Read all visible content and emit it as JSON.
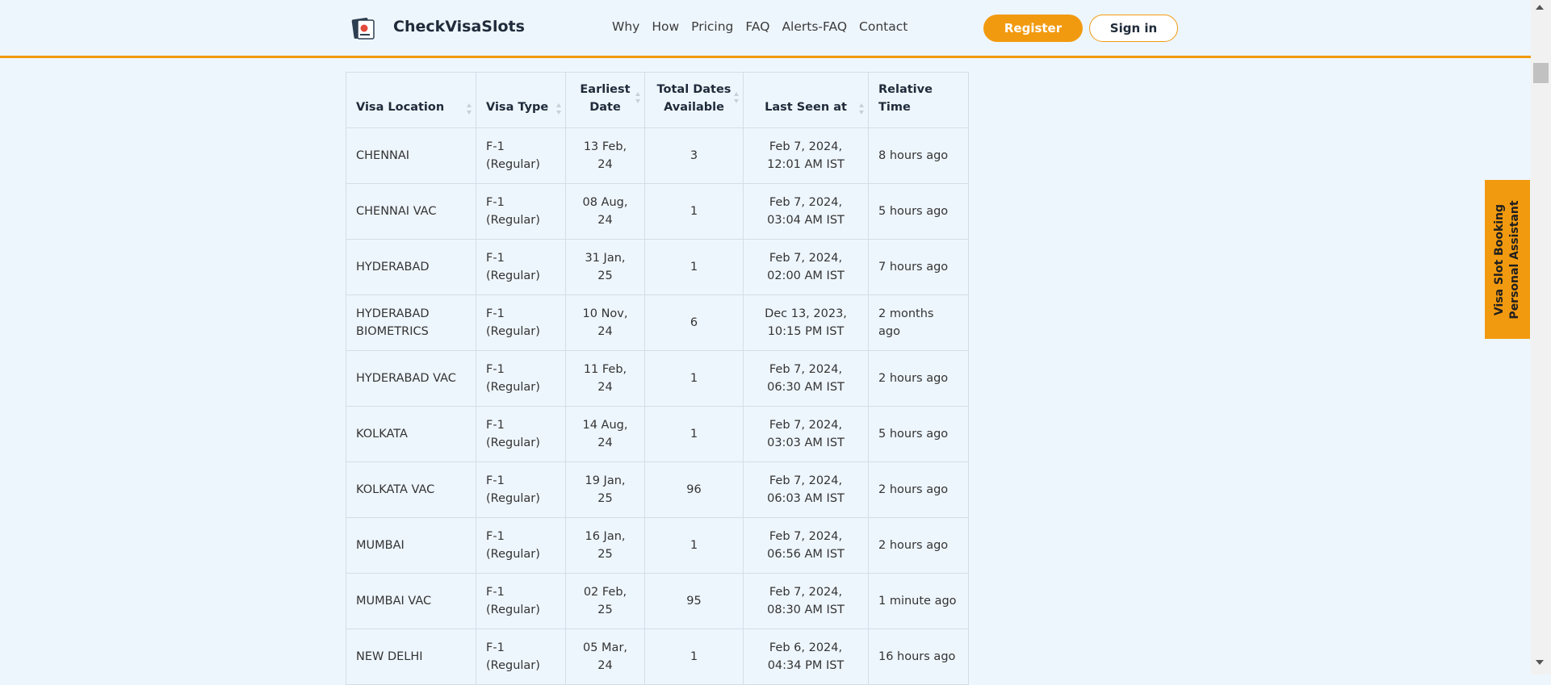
{
  "header": {
    "brand": "CheckVisaSlots",
    "nav": [
      "Why",
      "How",
      "Pricing",
      "FAQ",
      "Alerts-FAQ",
      "Contact"
    ],
    "register_label": "Register",
    "signin_label": "Sign in"
  },
  "table": {
    "columns": [
      {
        "line1": "",
        "line2": "Visa Location"
      },
      {
        "line1": "",
        "line2": "Visa Type"
      },
      {
        "line1": "Earliest",
        "line2": "Date"
      },
      {
        "line1": "Total Dates",
        "line2": "Available"
      },
      {
        "line1": "",
        "line2": "Last Seen at"
      },
      {
        "line1": "",
        "line2": "Relative Time"
      }
    ],
    "rows": [
      {
        "location": "CHENNAI",
        "type": "F-1 (Regular)",
        "earliest": "13 Feb, 24",
        "total": "3",
        "last_seen": "Feb 7, 2024, 12:01 AM IST",
        "relative": "8 hours ago"
      },
      {
        "location": "CHENNAI VAC",
        "type": "F-1 (Regular)",
        "earliest": "08 Aug, 24",
        "total": "1",
        "last_seen": "Feb 7, 2024, 03:04 AM IST",
        "relative": "5 hours ago"
      },
      {
        "location": "HYDERABAD",
        "type": "F-1 (Regular)",
        "earliest": "31 Jan, 25",
        "total": "1",
        "last_seen": "Feb 7, 2024, 02:00 AM IST",
        "relative": "7 hours ago"
      },
      {
        "location": "HYDERABAD BIOMETRICS",
        "type": "F-1 (Regular)",
        "earliest": "10 Nov, 24",
        "total": "6",
        "last_seen": "Dec 13, 2023, 10:15 PM IST",
        "relative": "2 months ago"
      },
      {
        "location": "HYDERABAD VAC",
        "type": "F-1 (Regular)",
        "earliest": "11 Feb, 24",
        "total": "1",
        "last_seen": "Feb 7, 2024, 06:30 AM IST",
        "relative": "2 hours ago"
      },
      {
        "location": "KOLKATA",
        "type": "F-1 (Regular)",
        "earliest": "14 Aug, 24",
        "total": "1",
        "last_seen": "Feb 7, 2024, 03:03 AM IST",
        "relative": "5 hours ago"
      },
      {
        "location": "KOLKATA VAC",
        "type": "F-1 (Regular)",
        "earliest": "19 Jan, 25",
        "total": "96",
        "last_seen": "Feb 7, 2024, 06:03 AM IST",
        "relative": "2 hours ago"
      },
      {
        "location": "MUMBAI",
        "type": "F-1 (Regular)",
        "earliest": "16 Jan, 25",
        "total": "1",
        "last_seen": "Feb 7, 2024, 06:56 AM IST",
        "relative": "2 hours ago"
      },
      {
        "location": "MUMBAI VAC",
        "type": "F-1 (Regular)",
        "earliest": "02 Feb, 25",
        "total": "95",
        "last_seen": "Feb 7, 2024, 08:30 AM IST",
        "relative": "1 minute ago"
      },
      {
        "location": "NEW DELHI",
        "type": "F-1 (Regular)",
        "earliest": "05 Mar, 24",
        "total": "1",
        "last_seen": "Feb 6, 2024, 04:34 PM IST",
        "relative": "16 hours ago"
      }
    ]
  },
  "sidetab": {
    "line1": "Visa Slot Booking",
    "line2": "Personal Assistant"
  },
  "colors": {
    "accent": "#f29a0f",
    "background": "#eef6fd"
  }
}
